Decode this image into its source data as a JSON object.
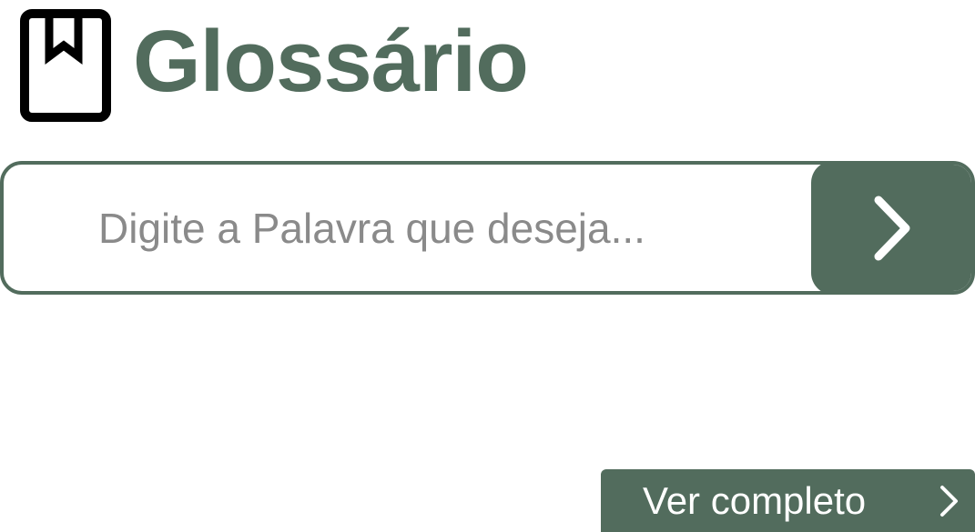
{
  "colors": {
    "accent": "#526c5d",
    "title": "#526c5d",
    "placeholder": "#8a8a8a",
    "icon": "#000000",
    "button_text": "#ffffff"
  },
  "header": {
    "icon": "bookmark-book-icon",
    "title": "Glossário"
  },
  "search": {
    "value": "",
    "placeholder": "Digite a Palavra que deseja...",
    "submit_icon": "chevron-right-icon"
  },
  "footer": {
    "view_full_label": "Ver completo",
    "view_full_icon": "chevron-right-icon"
  }
}
